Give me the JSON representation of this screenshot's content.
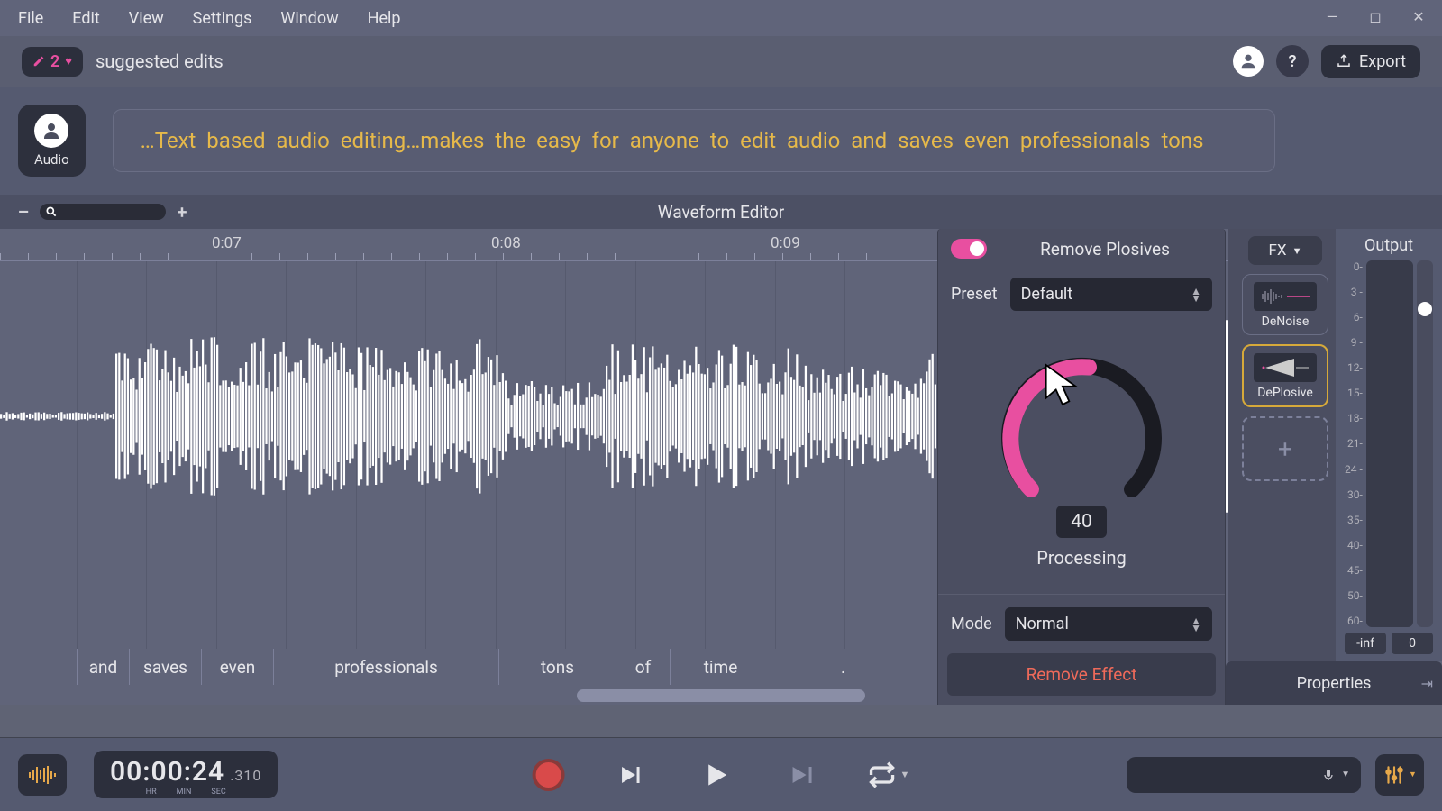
{
  "menu": {
    "items": [
      "File",
      "Edit",
      "View",
      "Settings",
      "Window",
      "Help"
    ]
  },
  "toolbar": {
    "edits_count": "2",
    "suggested_label": "suggested edits",
    "help_label": "?",
    "export_label": "Export"
  },
  "transcript": {
    "track_label": "Audio",
    "text": "…Text based audio editing…makes the easy for anyone to edit audio and saves even professionals tons"
  },
  "waveform": {
    "title": "Waveform Editor",
    "zoom_minus": "–",
    "zoom_plus": "+",
    "time_ticks": [
      "0:07",
      "0:08",
      "0:09"
    ],
    "words": [
      "and",
      "saves",
      "even",
      "professionals",
      "tons",
      "of",
      "time",
      "."
    ]
  },
  "effect": {
    "title": "Remove Plosives",
    "preset_label": "Preset",
    "preset_value": "Default",
    "knob_value": "40",
    "knob_label": "Processing",
    "mode_label": "Mode",
    "mode_value": "Normal",
    "remove_label": "Remove Effect"
  },
  "fx_chain": {
    "header": "FX",
    "slots": [
      {
        "name": "DeNoise"
      },
      {
        "name": "DePlosive"
      }
    ],
    "add": "+"
  },
  "output": {
    "title": "Output",
    "scale": [
      "0-",
      "3 -",
      "6-",
      "9 -",
      "12-",
      "15-",
      "18-",
      "21-",
      "24 -",
      "30-",
      "35-",
      "40-",
      "45-",
      "50-",
      "60-"
    ],
    "val_left": "-inf",
    "val_right": "0"
  },
  "properties": {
    "label": "Properties"
  },
  "transport": {
    "time_main": "00:00:24",
    "time_frac": ".310",
    "time_labels": [
      "HR",
      "MIN",
      "SEC"
    ]
  }
}
